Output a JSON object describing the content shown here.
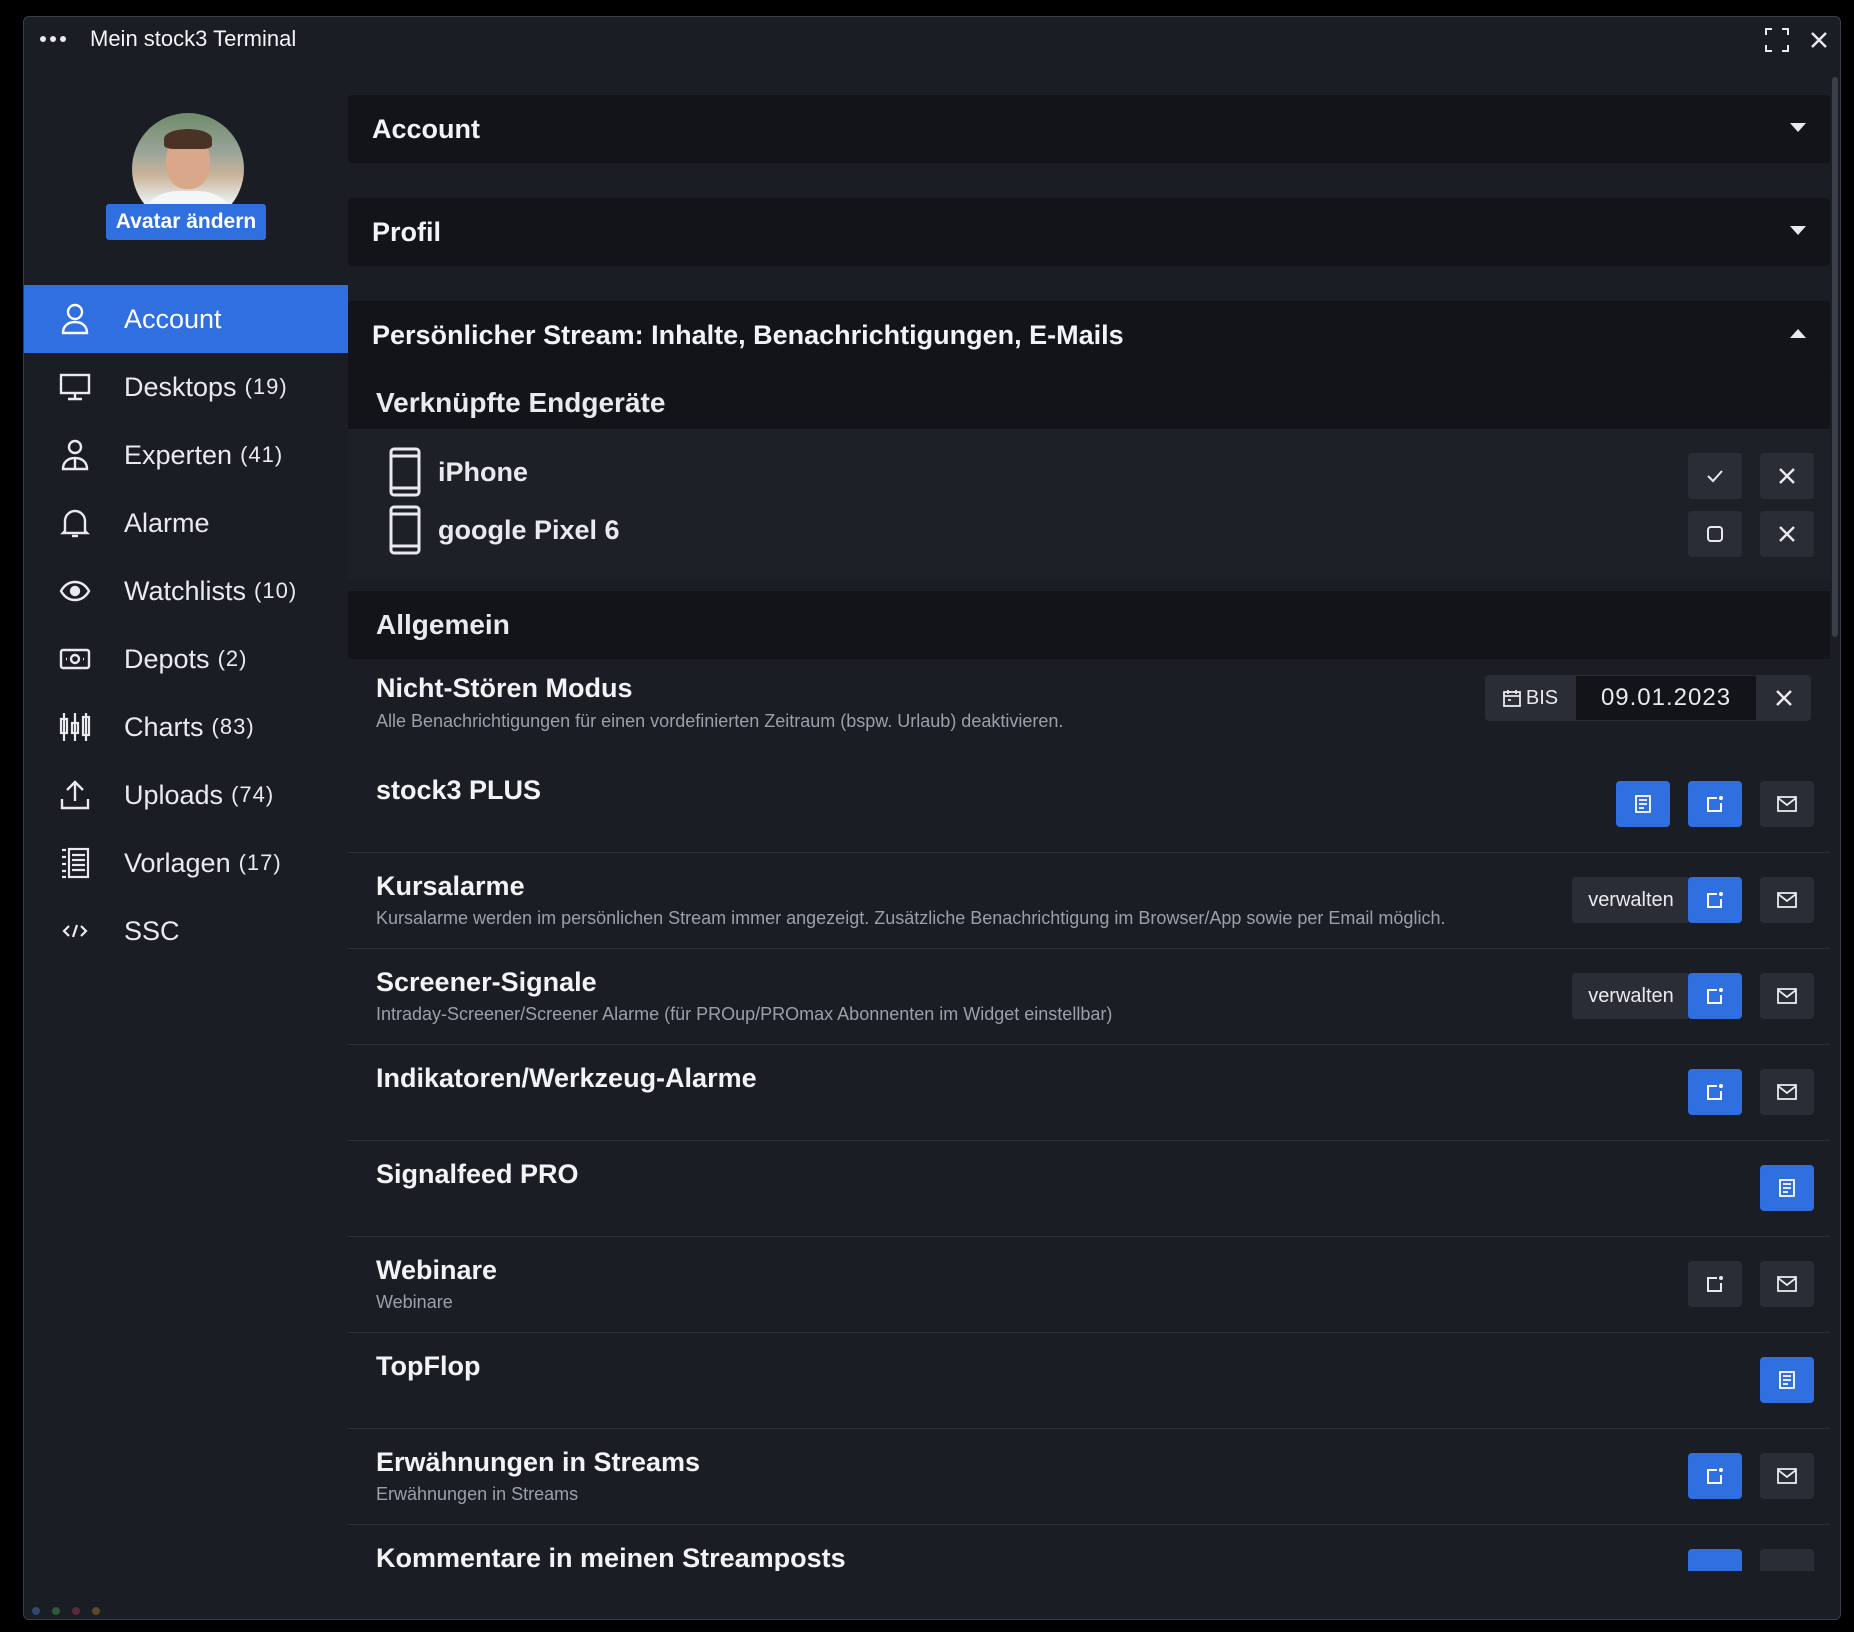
{
  "window": {
    "title": "Mein stock3 Terminal"
  },
  "sidebar": {
    "avatar_button": "Avatar ändern",
    "items": [
      {
        "label": "Account",
        "count": "",
        "icon": "user-icon",
        "active": true
      },
      {
        "label": "Desktops",
        "count": "(19)",
        "icon": "monitor-icon"
      },
      {
        "label": "Experten",
        "count": "(41)",
        "icon": "expert-icon"
      },
      {
        "label": "Alarme",
        "count": "",
        "icon": "bell-icon"
      },
      {
        "label": "Watchlists",
        "count": "(10)",
        "icon": "eye-icon"
      },
      {
        "label": "Depots",
        "count": "(2)",
        "icon": "cash-icon"
      },
      {
        "label": "Charts",
        "count": "(83)",
        "icon": "candlestick-icon"
      },
      {
        "label": "Uploads",
        "count": "(74)",
        "icon": "upload-icon"
      },
      {
        "label": "Vorlagen",
        "count": "(17)",
        "icon": "template-icon"
      },
      {
        "label": "SSC",
        "count": "",
        "icon": "code-icon"
      }
    ]
  },
  "main": {
    "panels": {
      "account": "Account",
      "profil": "Profil",
      "stream": "Persönlicher Stream: Inhalte, Benachrichtigungen, E-Mails"
    },
    "devices": {
      "title": "Verknüpfte Endgeräte",
      "items": [
        {
          "name": "iPhone",
          "checked": true
        },
        {
          "name": "google Pixel 6",
          "checked": false
        }
      ]
    },
    "allgemein": {
      "title": "Allgemein",
      "rows": [
        {
          "title": "Nicht-Stören Modus",
          "subtitle": "Alle Benachrichtigungen für einen vordefinierten Zeitraum (bspw. Urlaub) deaktivieren.",
          "date_label": "BIS",
          "date_value": "09.01.2023"
        },
        {
          "title": "stock3 PLUS",
          "subtitle": ""
        },
        {
          "title": "Kursalarme",
          "subtitle": "Kursalarme werden im persönlichen Stream immer angezeigt. Zusätzliche Benachrichtigung im Browser/App sowie per Email möglich.",
          "manage": "verwalten"
        },
        {
          "title": "Screener-Signale",
          "subtitle": "Intraday-Screener/Screener Alarme (für PROup/PROmax Abonnenten im Widget einstellbar)",
          "manage": "verwalten"
        },
        {
          "title": "Indikatoren/Werkzeug-Alarme",
          "subtitle": ""
        },
        {
          "title": "Signalfeed PRO",
          "subtitle": ""
        },
        {
          "title": "Webinare",
          "subtitle": "Webinare"
        },
        {
          "title": "TopFlop",
          "subtitle": ""
        },
        {
          "title": "Erwähnungen in Streams",
          "subtitle": "Erwähnungen in Streams"
        },
        {
          "title": "Kommentare in meinen Streamposts",
          "subtitle": ""
        }
      ]
    }
  },
  "colors": {
    "accent": "#2f6fe0",
    "background": "#1a1d24",
    "panel": "#12141a"
  }
}
